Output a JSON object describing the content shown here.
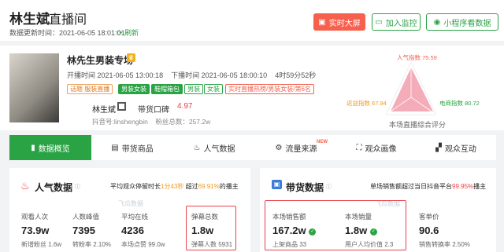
{
  "header": {
    "title": "林生斌",
    "subtitle": "直播间",
    "update_time": "数据更新时间：2021-06-05 18:01:01",
    "refresh_label": "刷新",
    "buttons": {
      "screen": "实时大屏",
      "monitor": "加入监控",
      "mini": "小程序看数据"
    }
  },
  "room": {
    "name": "林先生男装专场",
    "start_time": "开播时间 2021-06-05 13:00:18",
    "end_time": "下播时间 2021-06-05 18:00:10",
    "duration": "4时59分52秒",
    "tags": [
      "话题 服装直播",
      "男装女装",
      "鞋帽箱包",
      "男装",
      "女装",
      "实时直播热榜/男装女装/第6名"
    ],
    "host": "林生斌",
    "praise_label": "带货口碑",
    "praise_value": "4.97",
    "douyin_id": "抖音号:linshengbin",
    "fans": "粉丝总数：257.2w"
  },
  "radar": {
    "popularity": "人气指数 75.59",
    "interaction": "返益指数 67.94",
    "ecommerce": "电商指数 80.72",
    "caption": "本场直播综合评分",
    "colors": {
      "fill": "#f3a3b1",
      "label_top": "#f7604c",
      "label_left": "#f29a1e",
      "label_right": "#2aa344"
    }
  },
  "tabs": [
    {
      "label": "数据概览",
      "icon": "bar-chart-icon"
    },
    {
      "label": "带货商品",
      "icon": "cart-icon"
    },
    {
      "label": "人气数据",
      "icon": "flame-icon"
    },
    {
      "label": "流量来源",
      "icon": "flow-icon",
      "badge": "NEW"
    },
    {
      "label": "观众画像",
      "icon": "portrait-icon"
    },
    {
      "label": "观众互动",
      "icon": "chat-icon"
    }
  ],
  "popularity_panel": {
    "title": "人气数据",
    "note_prefix": "平均观众停留时长",
    "note_time": "1分43秒",
    "note_mid": "超过",
    "note_pct": "69.91%",
    "note_suffix": "的播主",
    "watermark": "飞瓜数据",
    "metrics": [
      {
        "label": "观看人次",
        "value": "73.9w",
        "sub": "新增粉丝 1.6w"
      },
      {
        "label": "人数峰值",
        "value": "7395",
        "sub": "转粉率 2.10%"
      },
      {
        "label": "平均在线",
        "value": "4236",
        "sub": "本场点赞 99.0w"
      },
      {
        "label": "弹幕总数",
        "value": "1.8w",
        "sub": "弹幕人数 5931"
      }
    ]
  },
  "sales_panel": {
    "title": "带货数据",
    "note_prefix": "单场销售额超过当日抖音平台",
    "note_pct": "99.95%",
    "note_suffix": "播主",
    "watermark": "飞瓜数据",
    "metrics": [
      {
        "label": "本场销售额",
        "value": "167.2w",
        "sub": "上架商品 33"
      },
      {
        "label": "本场销量",
        "value": "1.8w",
        "sub": "用户人均价值 2.3"
      },
      {
        "label": "客单价",
        "value": "90.6",
        "sub": "销售转换率 2.50%"
      }
    ]
  }
}
